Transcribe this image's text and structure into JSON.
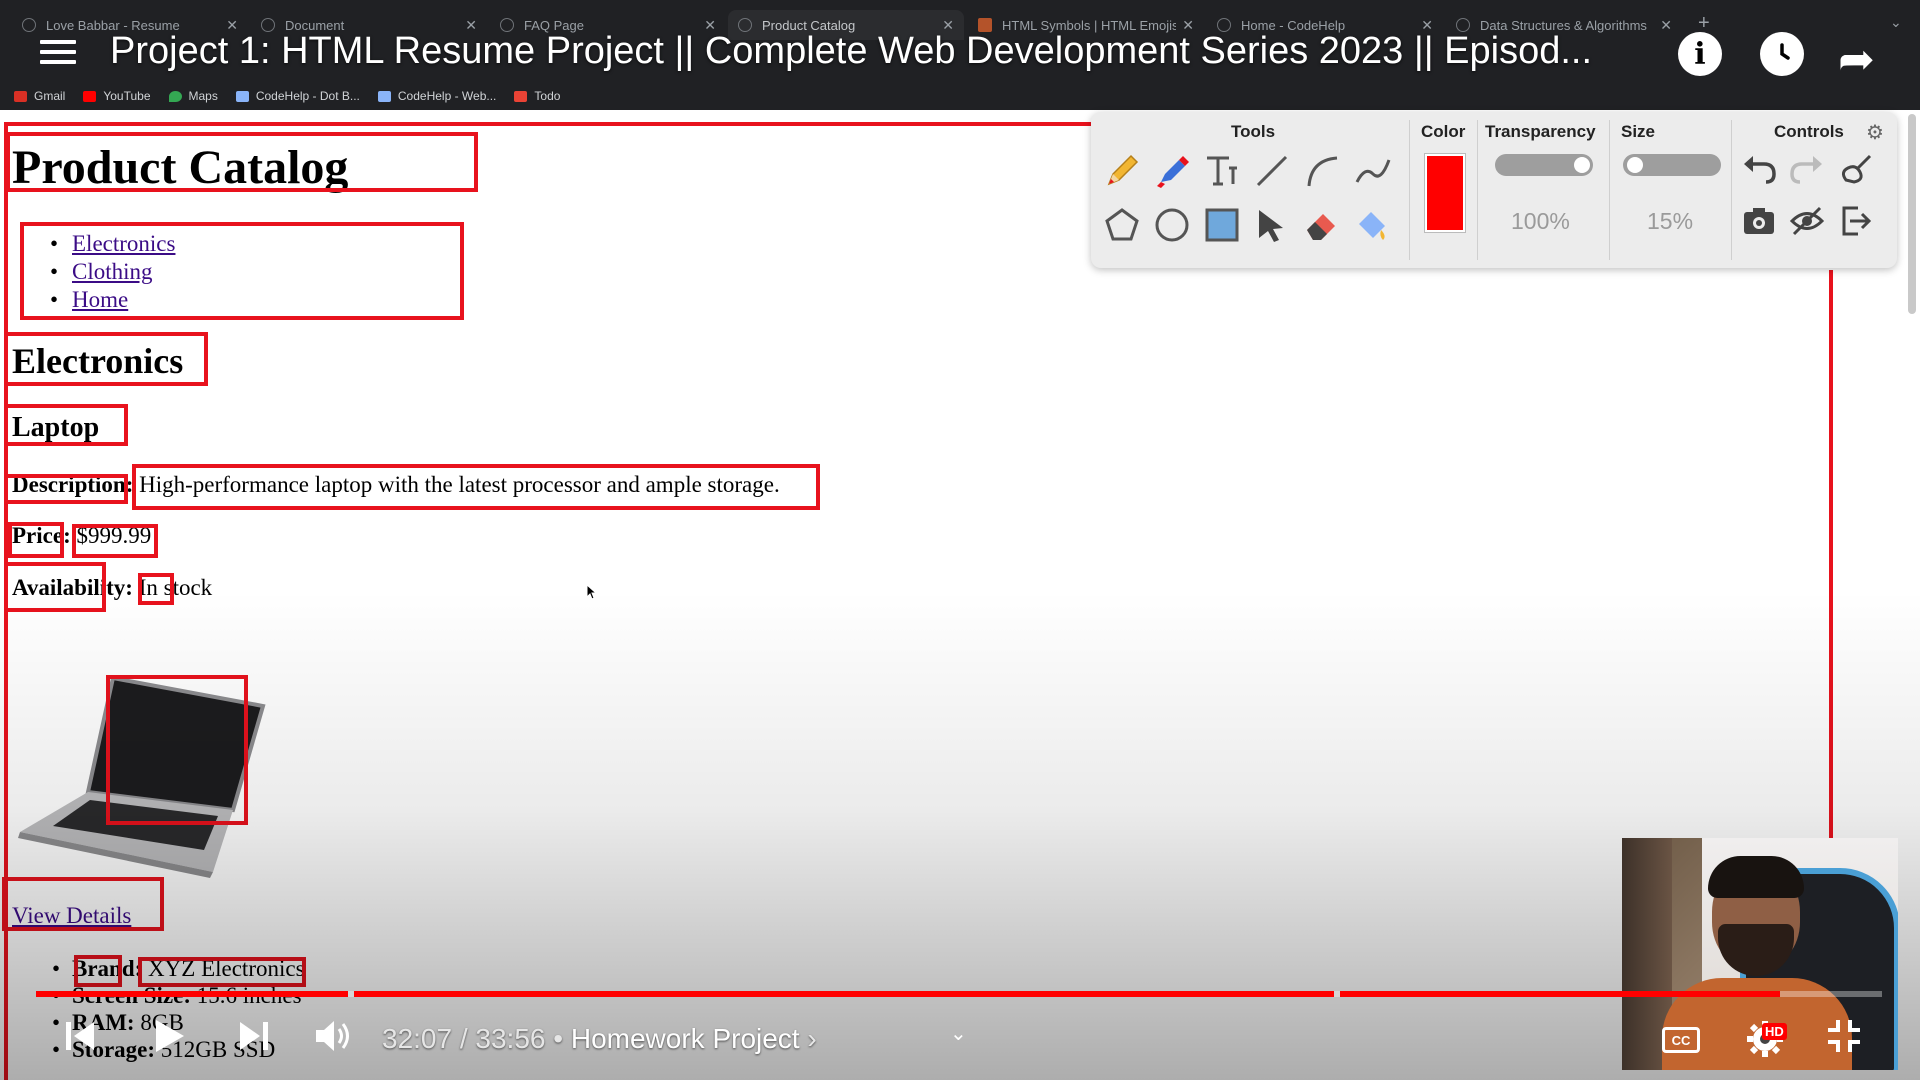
{
  "browser": {
    "tabs": [
      {
        "label": "Love Babbar - Resume",
        "active": false
      },
      {
        "label": "Document",
        "active": false
      },
      {
        "label": "FAQ Page",
        "active": false
      },
      {
        "label": "Product Catalog",
        "active": true
      },
      {
        "label": "HTML Symbols | HTML Emojis",
        "active": false
      },
      {
        "label": "Home - CodeHelp",
        "active": false
      },
      {
        "label": "Data Structures & Algorithms",
        "active": false
      }
    ],
    "bookmarks": [
      {
        "label": "Gmail",
        "color": "#d93025"
      },
      {
        "label": "YouTube",
        "color": "#ff0000"
      },
      {
        "label": "Maps",
        "color": "#34a853"
      },
      {
        "label": "CodeHelp - Dot B...",
        "color": "#8ab4f8"
      },
      {
        "label": "CodeHelp - Web...",
        "color": "#8ab4f8"
      },
      {
        "label": "Todo",
        "color": "#ea4335"
      }
    ]
  },
  "video": {
    "title": "Project 1: HTML Resume Project || Complete Web Development Series 2023 || Episod...",
    "time": "32:07 / 33:56",
    "chapter": "Homework Project",
    "progress": 0.945
  },
  "page": {
    "heading": "Product Catalog",
    "nav": [
      "Electronics",
      "Clothing",
      "Home"
    ],
    "section": "Electronics",
    "product": "Laptop",
    "description_label": "Description:",
    "description": "High-performance laptop with the latest processor and ample storage.",
    "price_label": "Price:",
    "price": "$999.99",
    "availability_label": "Availability:",
    "availability": "In stock",
    "view_details": "View Details",
    "specs": [
      {
        "label": "Brand:",
        "value": "XYZ Electronics"
      },
      {
        "label": "Screen Size:",
        "value": "15.6 inches"
      },
      {
        "label": "RAM:",
        "value": "8GB"
      },
      {
        "label": "Storage:",
        "value": "512GB SSD"
      }
    ]
  },
  "toolbox": {
    "tools_label": "Tools",
    "color_label": "Color",
    "transparency_label": "Transparency",
    "size_label": "Size",
    "controls_label": "Controls",
    "color": "#ff0000",
    "transparency": "100%",
    "size": "15%",
    "tools": [
      "pencil-icon",
      "marker-icon",
      "text-icon",
      "line-icon",
      "curve-icon",
      "connector-icon",
      "polygon-icon",
      "circle-icon",
      "rectangle-icon",
      "select-arrow-icon",
      "eraser-icon",
      "fill-bucket-icon"
    ],
    "controls": [
      "undo-icon",
      "redo-icon",
      "clear-icon",
      "screenshot-icon",
      "hide-icon",
      "exit-icon"
    ]
  }
}
